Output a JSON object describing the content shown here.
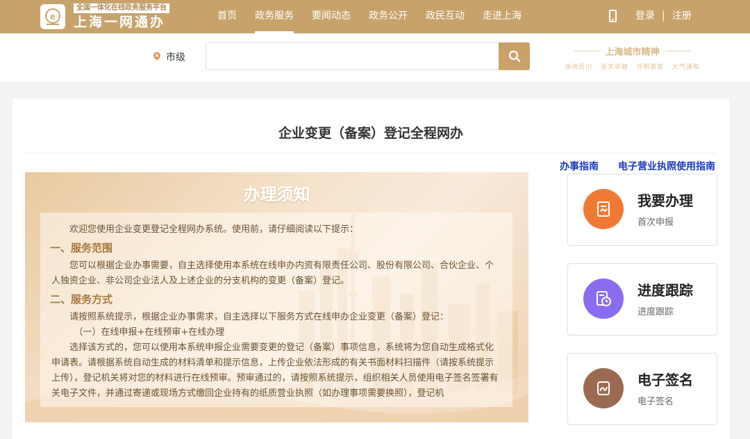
{
  "header": {
    "logo_subtitle": "全国一体化在线政务服务平台",
    "logo_title": "上海一网通办",
    "nav": [
      "首页",
      "政务服务",
      "要闻动态",
      "政务公开",
      "政民互动",
      "走进上海"
    ],
    "active_nav": "政务服务",
    "login": "登录",
    "separator": "|",
    "register": "注册",
    "brand_color": "#c7a36b"
  },
  "search": {
    "location": "市级",
    "placeholder": "",
    "value": ""
  },
  "city_spirit": {
    "title": "上海城市精神",
    "words": "海纳百川 · 追求卓越 · 开明睿智 · 大气谦和"
  },
  "page": {
    "title": "企业变更（备案）登记全程网办",
    "links": [
      "办事指南",
      "电子营业执照使用指南"
    ],
    "link_color": "#1a39c6"
  },
  "notice": {
    "heading": "办理须知",
    "intro": "欢迎您使用企业变更登记全程网办系统。使用前，请仔细阅读以下提示：",
    "section1_title": "一、服务范围",
    "section1_text": "您可以根据企业办事需要，自主选择使用本系统在线申办内资有限责任公司、股份有限公司、合伙企业、个人独资企业、非公司企业法人及上述企业的分支机构的变更（备案）登记。",
    "section2_title": "二、服务方式",
    "section2_text": "请按照系统提示，根据企业办事需求，自主选择以下服务方式在线申办企业变更（备案）登记：",
    "option1": "（一）在线申报+在线预审+在线办理",
    "option1_text": "选择该方式的，您可以使用本系统申报企业需要变更的登记（备案）事项信息，系统将为您自动生成格式化申请表。请根据系统自动生成的材料清单和提示信息，上传企业依法形成的有关书面材料扫描件（请按系统提示上传），登记机关将对您的材料进行在线预审。预审通过的，请按照系统提示，组织相关人员使用电子签名签署有关电子文件，并通过寄递或现场方式缴回企业持有的纸质营业执照（如办理事项需要换照），登记机"
  },
  "actions": [
    {
      "title": "我要办理",
      "subtitle": "首次申报",
      "icon": "form-edit-icon",
      "color": "#f07a35"
    },
    {
      "title": "进度跟踪",
      "subtitle": "进度跟踪",
      "icon": "clock-doc-icon",
      "color": "#8a6cf0"
    },
    {
      "title": "电子签名",
      "subtitle": "电子签名",
      "icon": "signature-icon",
      "color": "#9a6b52"
    }
  ]
}
